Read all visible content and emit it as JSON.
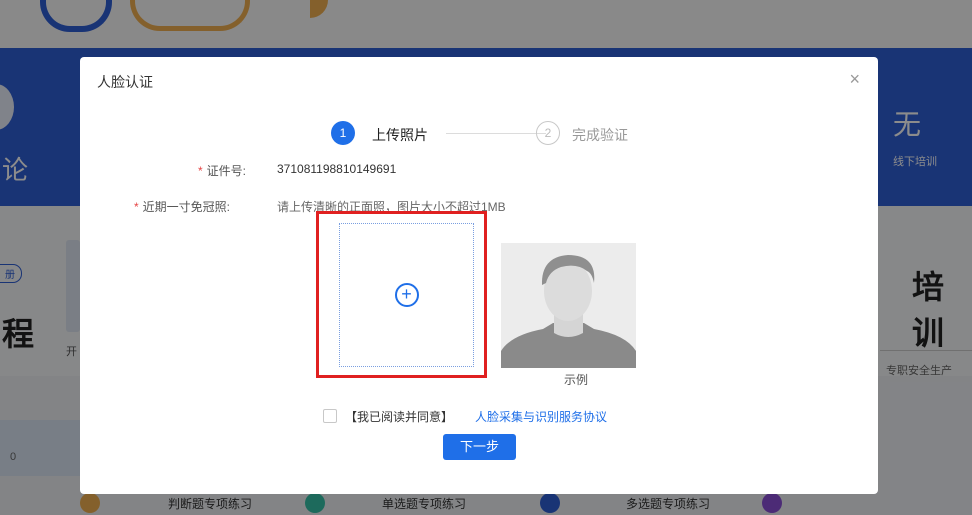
{
  "modal": {
    "title": "人脸认证",
    "close": "×",
    "steps": [
      {
        "number": "1",
        "label": "上传照片",
        "active": true
      },
      {
        "number": "2",
        "label": "完成验证",
        "active": false
      }
    ],
    "id_label": "证件号:",
    "id_value": "371081198810149691",
    "photo_label": "近期一寸免冠照:",
    "photo_hint": "请上传清晰的正面照，图片大小不超过1MB",
    "upload_icon": "plus-circle-icon",
    "sample_label": "示例",
    "agree_text": "【我已阅读并同意】",
    "agree_link": "人脸采集与识别服务协议",
    "next_button": "下一步",
    "required_mark": "*"
  },
  "background": {
    "right_big": "无",
    "right_small": "线下培训",
    "left_char": "论",
    "pill": "册",
    "left_big": "程",
    "left_small": "开",
    "right_heading": "培训",
    "right_sub": "专职安全生产",
    "zero": "0",
    "bottom_items": [
      "判断题专项练习",
      "单选题专项练习",
      "多选题专项练习"
    ]
  },
  "colors": {
    "primary": "#1f6fe8",
    "band": "#2f5fd6",
    "highlight": "#e02020",
    "required": "#e54545"
  }
}
